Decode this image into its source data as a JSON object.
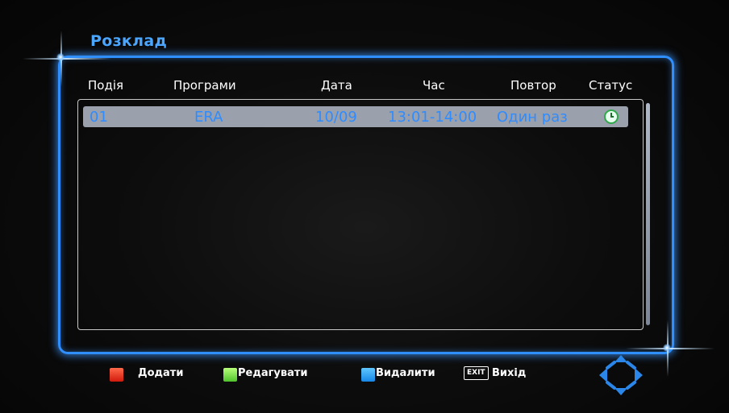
{
  "screen": {
    "title": "Розклад"
  },
  "columns": [
    "Подія",
    "Програми",
    "Дата",
    "Час",
    "Повтор",
    "Статус"
  ],
  "rows": [
    {
      "event": "01",
      "program": "ERA",
      "date": "10/09",
      "time": "13:01-14:00",
      "repeat": "Один раз",
      "status_icon": "alarm-clock-icon"
    }
  ],
  "footer": {
    "add_label": "Додати",
    "edit_label": "Редагувати",
    "delete_label": "Видалити",
    "exit_key": "EXIT",
    "exit_label": "Вихід"
  },
  "icons": {
    "add_key": "red-key-icon",
    "edit_key": "green-key-icon",
    "delete_key": "blue-key-icon",
    "navigation": "dpad-arrows-icon"
  },
  "colors": {
    "accent": "#2f8fff",
    "title": "#4aa6ff",
    "row_highlight": "#9aa0ac",
    "row_text": "#2f8cff",
    "red_key": "#e0301a",
    "green_key": "#6fd83c",
    "blue_key": "#2a9cf0"
  }
}
